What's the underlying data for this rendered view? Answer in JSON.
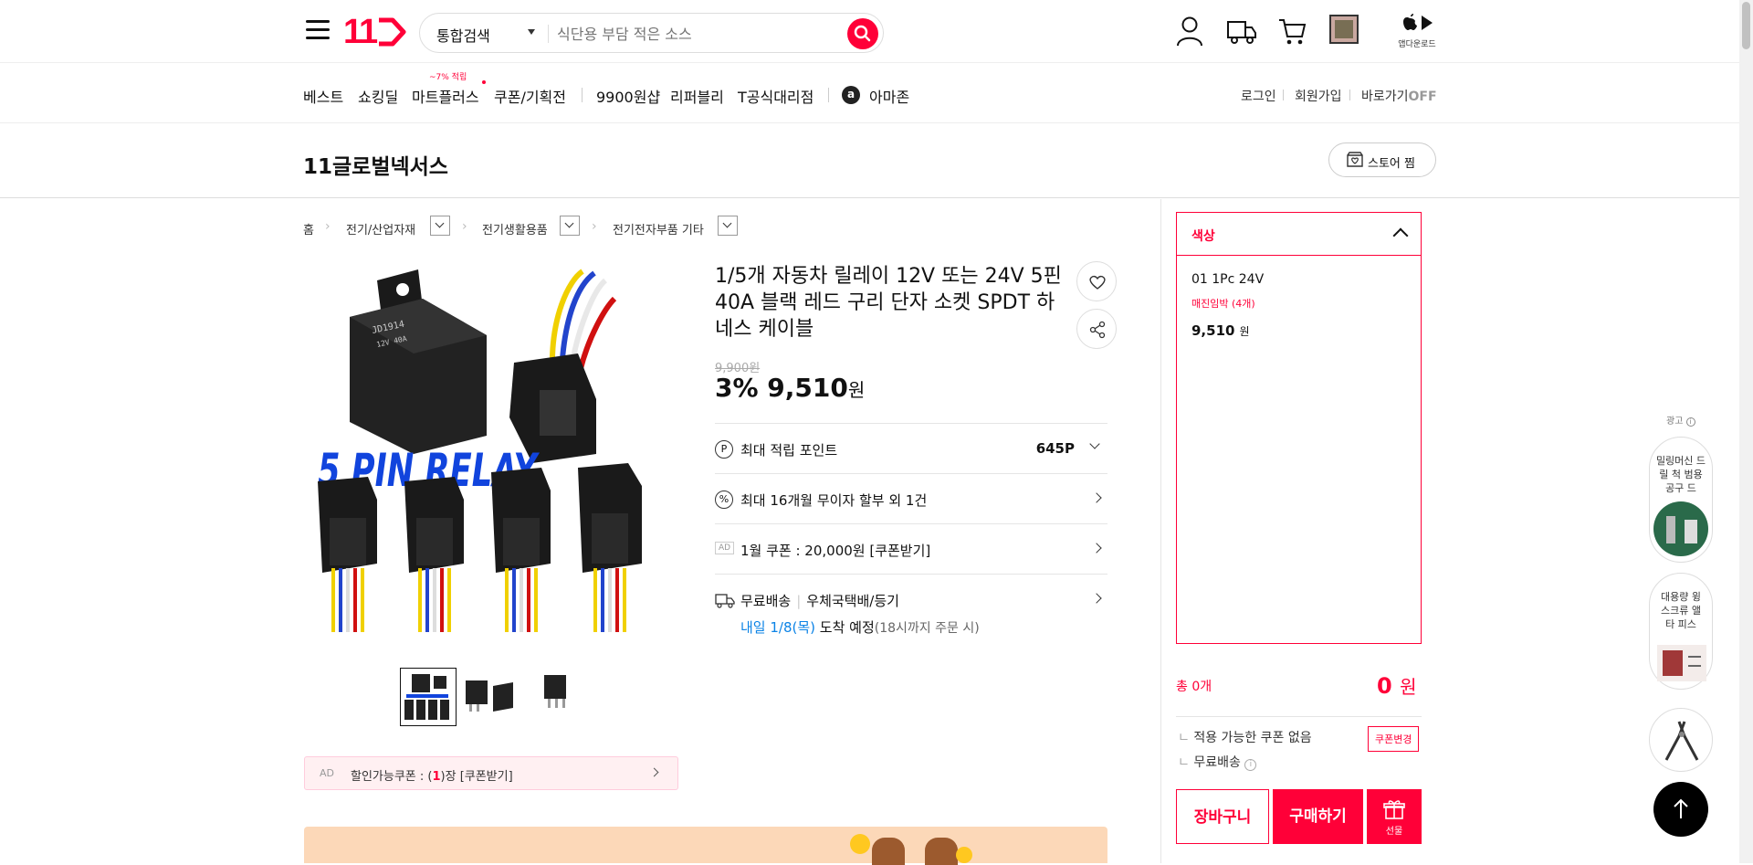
{
  "header": {
    "logo": "11",
    "search_category": "통합검색",
    "search_placeholder": "식단용 부담 적은 소스",
    "app_download": "앱다운로드"
  },
  "nav": {
    "items": [
      "베스트",
      "쇼킹딜",
      "마트플러스",
      "쿠폰/기획전",
      "9900원샵",
      "리퍼블리",
      "T공식대리점",
      "아마존"
    ],
    "mart_badge": "~7% 적립",
    "right": [
      "로그인",
      "회원가입",
      "바로가기"
    ],
    "off": "OFF"
  },
  "store": {
    "name": "11글로벌넥서스",
    "fav_label": "스토어 찜"
  },
  "breadcrumb": [
    "홈",
    "전기/산업자재",
    "전기생활용품",
    "전기전자부품 기타"
  ],
  "product": {
    "image_text": "5 PIN RELAY",
    "relay_label": "JD1914\n12V  40A",
    "title": "1/5개 자동차 릴레이 12V 또는 24V 5핀 40A 블랙 레드 구리 단자 소켓 SPDT 하네스 케이블",
    "original_price": "9,900원",
    "discount_rate": "3%",
    "price": "9,510",
    "price_unit": "원",
    "rows": {
      "points_label": "최대 적립 포인트",
      "points_value": "645P",
      "installment": "최대 16개월 무이자 할부 외 1건",
      "coupon": "1월 쿠폰 : 20,000원 [쿠폰받기]",
      "ad_tag": "AD",
      "shipping": "무료배송",
      "shipping_method": "우체국택배/등기",
      "arrival_date": "내일 1/8(목)",
      "arrival_text": "도착 예정",
      "arrival_note": "(18시까지 주문 시)"
    },
    "coupon_bar": {
      "ad": "AD",
      "text_prefix": "할인가능쿠폰 : (",
      "count": "1",
      "text_suffix": ")장 [쿠폰받기]"
    }
  },
  "options": {
    "header": "색상",
    "item_name": "01 1Pc 24V",
    "stock": "매진임박 (4개)",
    "item_price": "9,510",
    "item_unit": "원"
  },
  "summary": {
    "total_label": "총 0개",
    "total_price": "0",
    "total_unit": "원",
    "coupon_none": "적용 가능한 쿠폰 없음",
    "coupon_change": "쿠폰변경",
    "free_ship": "무료배송"
  },
  "buttons": {
    "cart": "장바구니",
    "buy": "구매하기",
    "gift": "선물"
  },
  "sidebar": {
    "ad_label": "광고",
    "card1": "밀링머신 드릴 척 범용 공구 드",
    "card2": "대용량 윙 스크류 앨 타 피스"
  },
  "colors": {
    "accent": "#ff0038",
    "blue": "#0b83e6"
  }
}
